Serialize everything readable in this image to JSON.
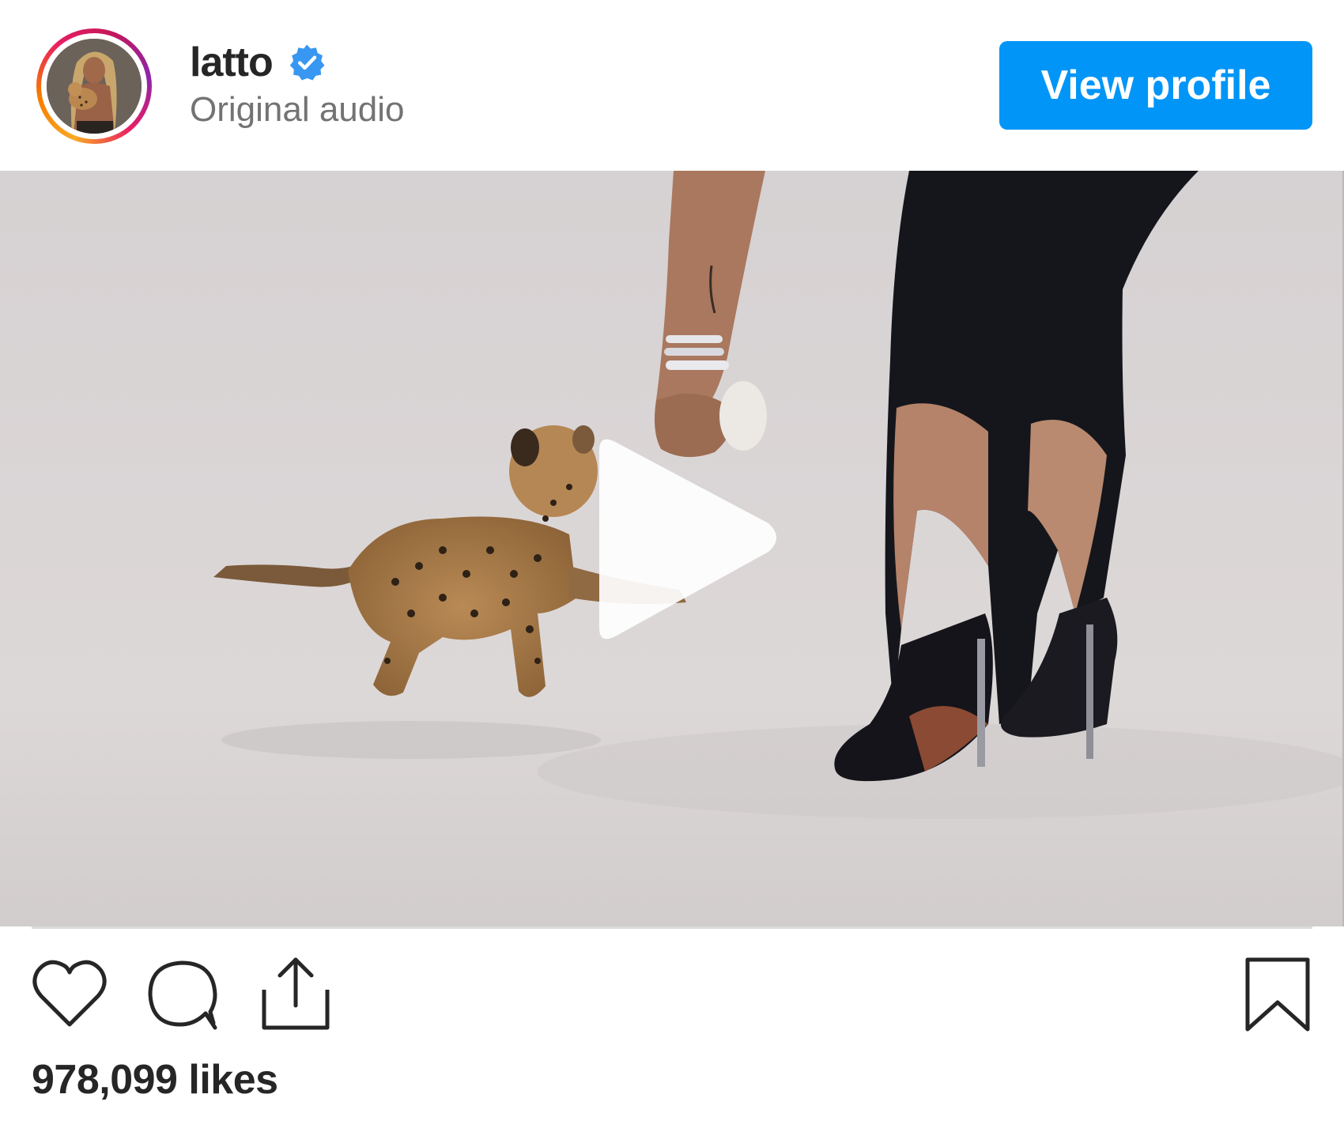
{
  "post": {
    "username": "latto",
    "verified": true,
    "subtitle": "Original audio",
    "view_profile_label": "View profile",
    "likes_text": "978,099 likes"
  },
  "media": {
    "type": "video",
    "state": "paused"
  },
  "icons": {
    "verified": "verified-badge-icon",
    "play": "play-icon",
    "like": "heart-icon",
    "comment": "comment-bubble-icon",
    "share": "share-upload-icon",
    "save": "bookmark-icon"
  },
  "colors": {
    "accent": "#0095f6",
    "verified": "#3897f0",
    "text_primary": "#262626",
    "text_secondary": "#737373"
  }
}
